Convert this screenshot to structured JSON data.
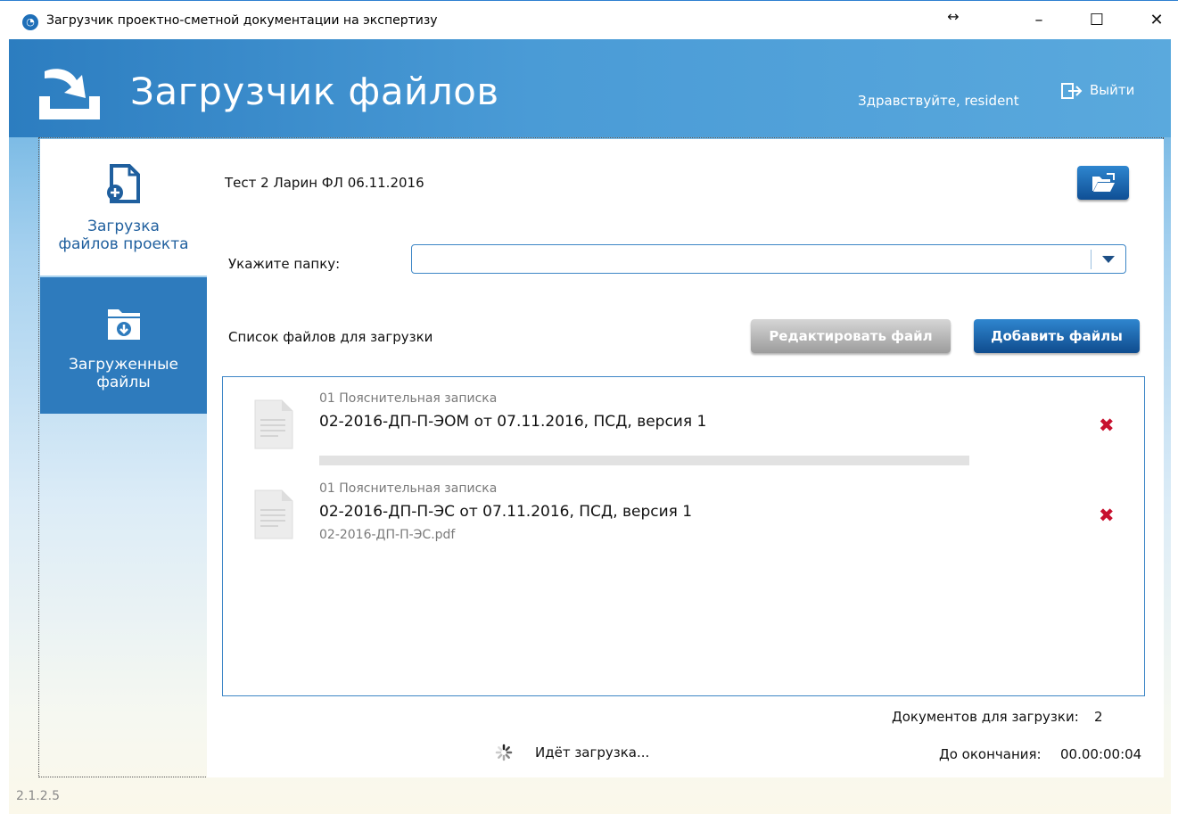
{
  "window": {
    "title": "Загрузчик проектно-сметной документации на экспертизу",
    "resize_glyph": "↔",
    "minimize_glyph": "–",
    "maximize_glyph": "☐",
    "close_glyph": "✕"
  },
  "header": {
    "brand": "Загрузчик файлов",
    "greeting": "Здравствуйте, resident",
    "logout_label": "Выйти"
  },
  "sidebar": {
    "items": [
      {
        "label_line1": "Загрузка",
        "label_line2": "файлов проекта",
        "icon": "file-add-icon",
        "active": true
      },
      {
        "label_line1": "Загруженные",
        "label_line2": "файлы",
        "icon": "folder-download-icon",
        "active": false
      }
    ]
  },
  "main": {
    "project_title": "Тест 2 Ларин ФЛ 06.11.2016",
    "folder_label": "Укажите папку:",
    "folder_value": "",
    "list_label": "Список файлов для загрузки",
    "edit_button": "Редактировать файл",
    "add_button": "Добавить файлы",
    "files": [
      {
        "category": "01 Пояснительная записка",
        "name": "02-2016-ДП-П-ЭОМ от 07.11.2016, ПСД, версия 1",
        "filename": "",
        "progress": 0.0
      },
      {
        "category": "01 Пояснительная записка",
        "name": "02-2016-ДП-П-ЭС от 07.11.2016, ПСД, версия 1",
        "filename": "02-2016-ДП-П-ЭС.pdf"
      }
    ],
    "remove_glyph": "✖",
    "docs_count_label": "Документов для загрузки:",
    "docs_count": "2",
    "status_text": "Идёт загрузка...",
    "eta_label": "До окончания:",
    "eta_value": "00.00:00:04"
  },
  "version": "2.1.2.5",
  "colors": {
    "accent": "#2e7bbd",
    "remove": "#c8102e",
    "border": "#3d86c6"
  }
}
